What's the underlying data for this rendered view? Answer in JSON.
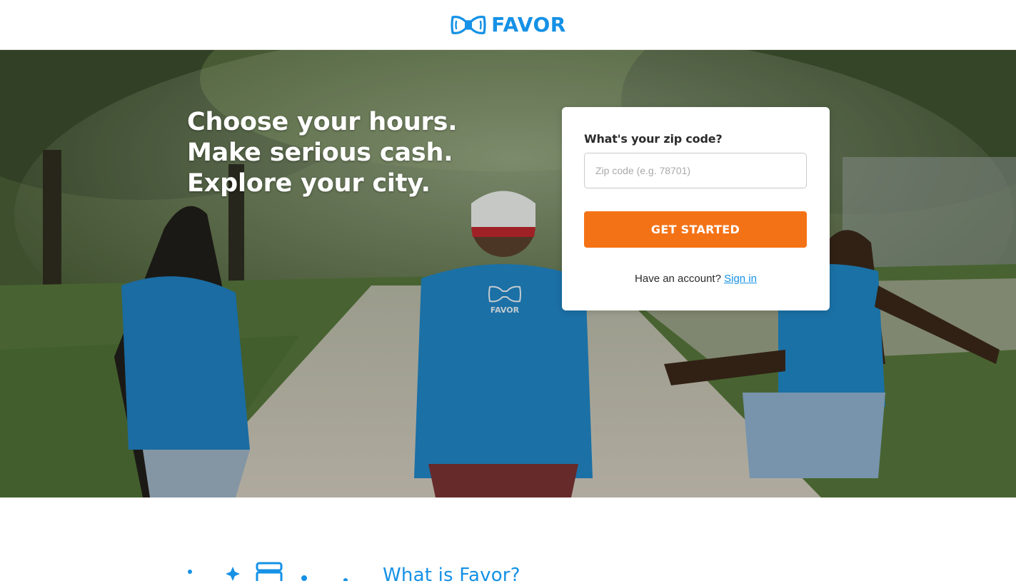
{
  "colors": {
    "brand_blue": "#1591e6",
    "accent_orange": "#f47216",
    "link_blue": "#1591e6"
  },
  "header": {
    "logo_icon": "bowtie-logo-icon",
    "logo_text": "FAVOR"
  },
  "hero": {
    "headline_lines": [
      "Choose your hours.",
      "Make serious cash.",
      "Explore your city."
    ],
    "shirt_logo_text": "FAVOR"
  },
  "signup_card": {
    "label": "What's your zip code?",
    "zip_placeholder": "Zip code (e.g. 78701)",
    "zip_value": "",
    "cta_label": "GET STARTED",
    "account_prompt": "Have an account?",
    "signin_label": "Sign in"
  },
  "below": {
    "illustration_icons": [
      "dot-icon",
      "sparkle-icon",
      "food-container-icon",
      "dot-icon",
      "dot-icon"
    ],
    "section_title": "What is Favor?"
  }
}
